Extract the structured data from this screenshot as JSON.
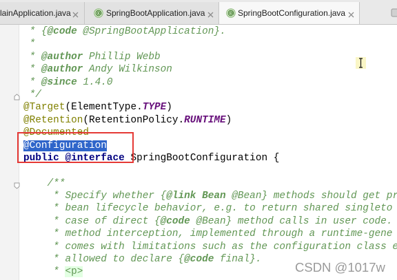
{
  "tabs": [
    {
      "label": "lainApplication.java",
      "close_icon": "close-icon"
    },
    {
      "label": "SpringBootApplication.java",
      "icon": "annotation-type-icon",
      "close_icon": "close-icon"
    },
    {
      "label": "SpringBootConfiguration.java",
      "icon": "annotation-type-icon",
      "close_icon": "close-icon"
    }
  ],
  "active_tab_index": 2,
  "tab_menu_icon": "tab-list-icon",
  "editor": {
    "gutter_icons": [
      "fold-end-icon",
      "fold-start-icon"
    ],
    "mouse_cursor_icon": "text-cursor-icon",
    "lines": [
      [
        " * {",
        "@code",
        " @SpringBootApplication}."
      ],
      [
        " *"
      ],
      [
        " * ",
        "@author",
        " Phillip Webb"
      ],
      [
        " * ",
        "@author",
        " Andy Wilkinson"
      ],
      [
        " * ",
        "@since",
        " 1.4.0"
      ],
      [
        " */"
      ],
      [
        "@Target",
        "(ElementType.",
        "TYPE",
        ")"
      ],
      [
        "@Retention",
        "(RetentionPolicy.",
        "RUNTIME",
        ")"
      ],
      [
        "@Documented"
      ],
      [
        "@Configuration"
      ],
      [
        "public",
        " @interface",
        " SpringBootConfiguration {"
      ],
      [],
      [
        "    /**"
      ],
      [
        "     * Specify whether {",
        "@link",
        " Bean",
        " @Bean} methods should get pr"
      ],
      [
        "     * bean lifecycle behavior, e.g. to return shared singleto"
      ],
      [
        "     * case of direct {",
        "@code",
        " @Bean} method calls in user code."
      ],
      [
        "     * method interception, implemented through a runtime-gene"
      ],
      [
        "     * comes with limitations such as the configuration class e"
      ],
      [
        "     * allowed to declare {",
        "@code",
        " final}."
      ],
      [
        "     * ",
        "<p>"
      ]
    ]
  },
  "watermark": "CSDN @1017w",
  "colors": {
    "annotation": "#808000",
    "keyword": "#000080",
    "constant": "#660e7a",
    "doc_comment": "#629755",
    "selection": "#2f65ca",
    "highlight_box": "#e53935"
  }
}
